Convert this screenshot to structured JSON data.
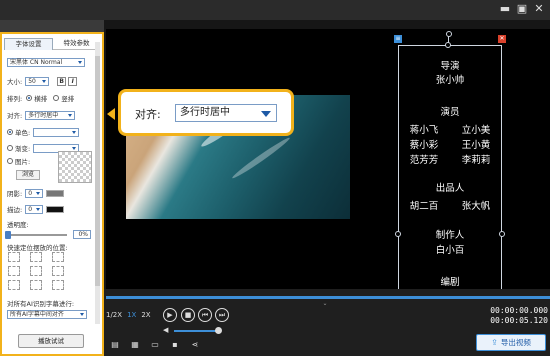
{
  "window": {
    "minimize": "▬",
    "restore": "▣",
    "close": "✕"
  },
  "panel": {
    "tabs": [
      {
        "label": "字体设置"
      },
      {
        "label": "特效参数"
      }
    ],
    "font_select": "宋黑体 CN Normal",
    "size_label": "大小:",
    "size_value": "50",
    "bold": "B",
    "italic": "I",
    "layout_label": "排列:",
    "horizontal": "横排",
    "vertical": "竖排",
    "align_label": "对齐:",
    "align_value": "多行时居中",
    "single_color": "单色:",
    "gradient": "渐变:",
    "texture": "图片:",
    "browse": "浏览",
    "shadow_label": "阴影:",
    "shadow_value": "0",
    "stroke_label": "描边:",
    "stroke_value": "0",
    "opacity_label": "透明度:",
    "opacity_value": "0%",
    "quickpos_label": "快速定位摆放的位置:",
    "ai_label": "对所有AI识别字幕进行:",
    "ai_value": "所有AI字幕中间对齐",
    "play_test": "播放试试"
  },
  "callout": {
    "label": "对齐:",
    "value": "多行时居中"
  },
  "credits": [
    {
      "type": "line",
      "text": "导演"
    },
    {
      "type": "line",
      "text": "张小帅"
    },
    {
      "type": "line",
      "text": "演员"
    },
    {
      "type": "pair",
      "left": "蒋小飞",
      "right": "立小美"
    },
    {
      "type": "pair",
      "left": "蔡小彩",
      "right": "王小黄"
    },
    {
      "type": "pair",
      "left": "范芳芳",
      "right": "李莉莉"
    },
    {
      "type": "line",
      "text": "出品人"
    },
    {
      "type": "pair",
      "left": "胡二百",
      "right": "张大帆"
    },
    {
      "type": "line",
      "text": "制作人"
    },
    {
      "type": "line",
      "text": "白小百"
    },
    {
      "type": "line",
      "text": "编剧"
    }
  ],
  "player": {
    "speeds": [
      "1/2X",
      "1X",
      "2X"
    ],
    "time_current": "00:00:00.000",
    "time_total": "00:00:05.120",
    "export": "导出视频"
  },
  "colors": {
    "accent": "#f2b21b",
    "blue": "#3d8fd8"
  }
}
